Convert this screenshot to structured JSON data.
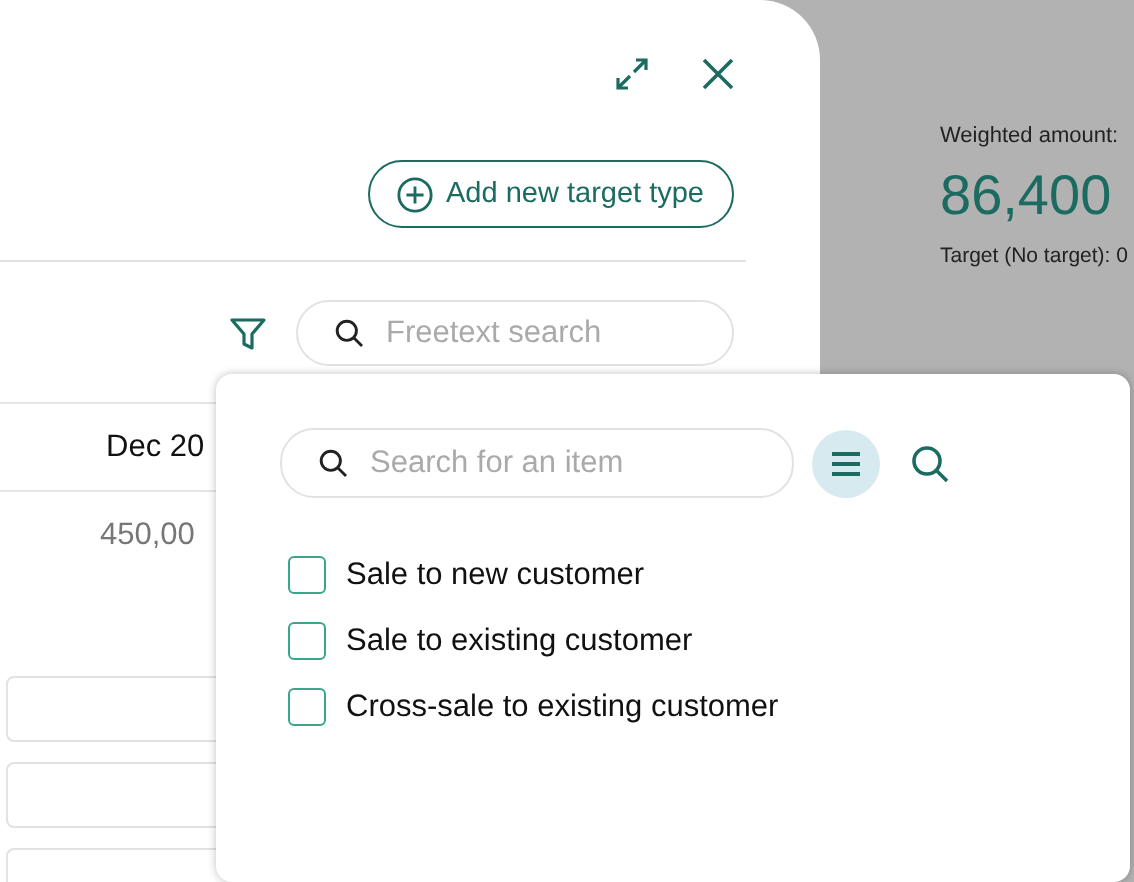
{
  "summary": {
    "label": "Weighted amount:",
    "amount": "86,400",
    "target": "Target (No target): 0"
  },
  "dialog": {
    "add_button": "Add new target type",
    "search": {
      "placeholder": "Freetext search"
    },
    "table": {
      "column_header": "Dec 20",
      "first_row_value": "450,00"
    }
  },
  "filter_popup": {
    "search": {
      "placeholder": "Search for an item"
    },
    "list_view_selected": true,
    "options": [
      {
        "label": "Sale to new customer",
        "checked": false
      },
      {
        "label": "Sale to existing customer",
        "checked": false
      },
      {
        "label": "Cross-sale to existing customer",
        "checked": false
      }
    ]
  }
}
